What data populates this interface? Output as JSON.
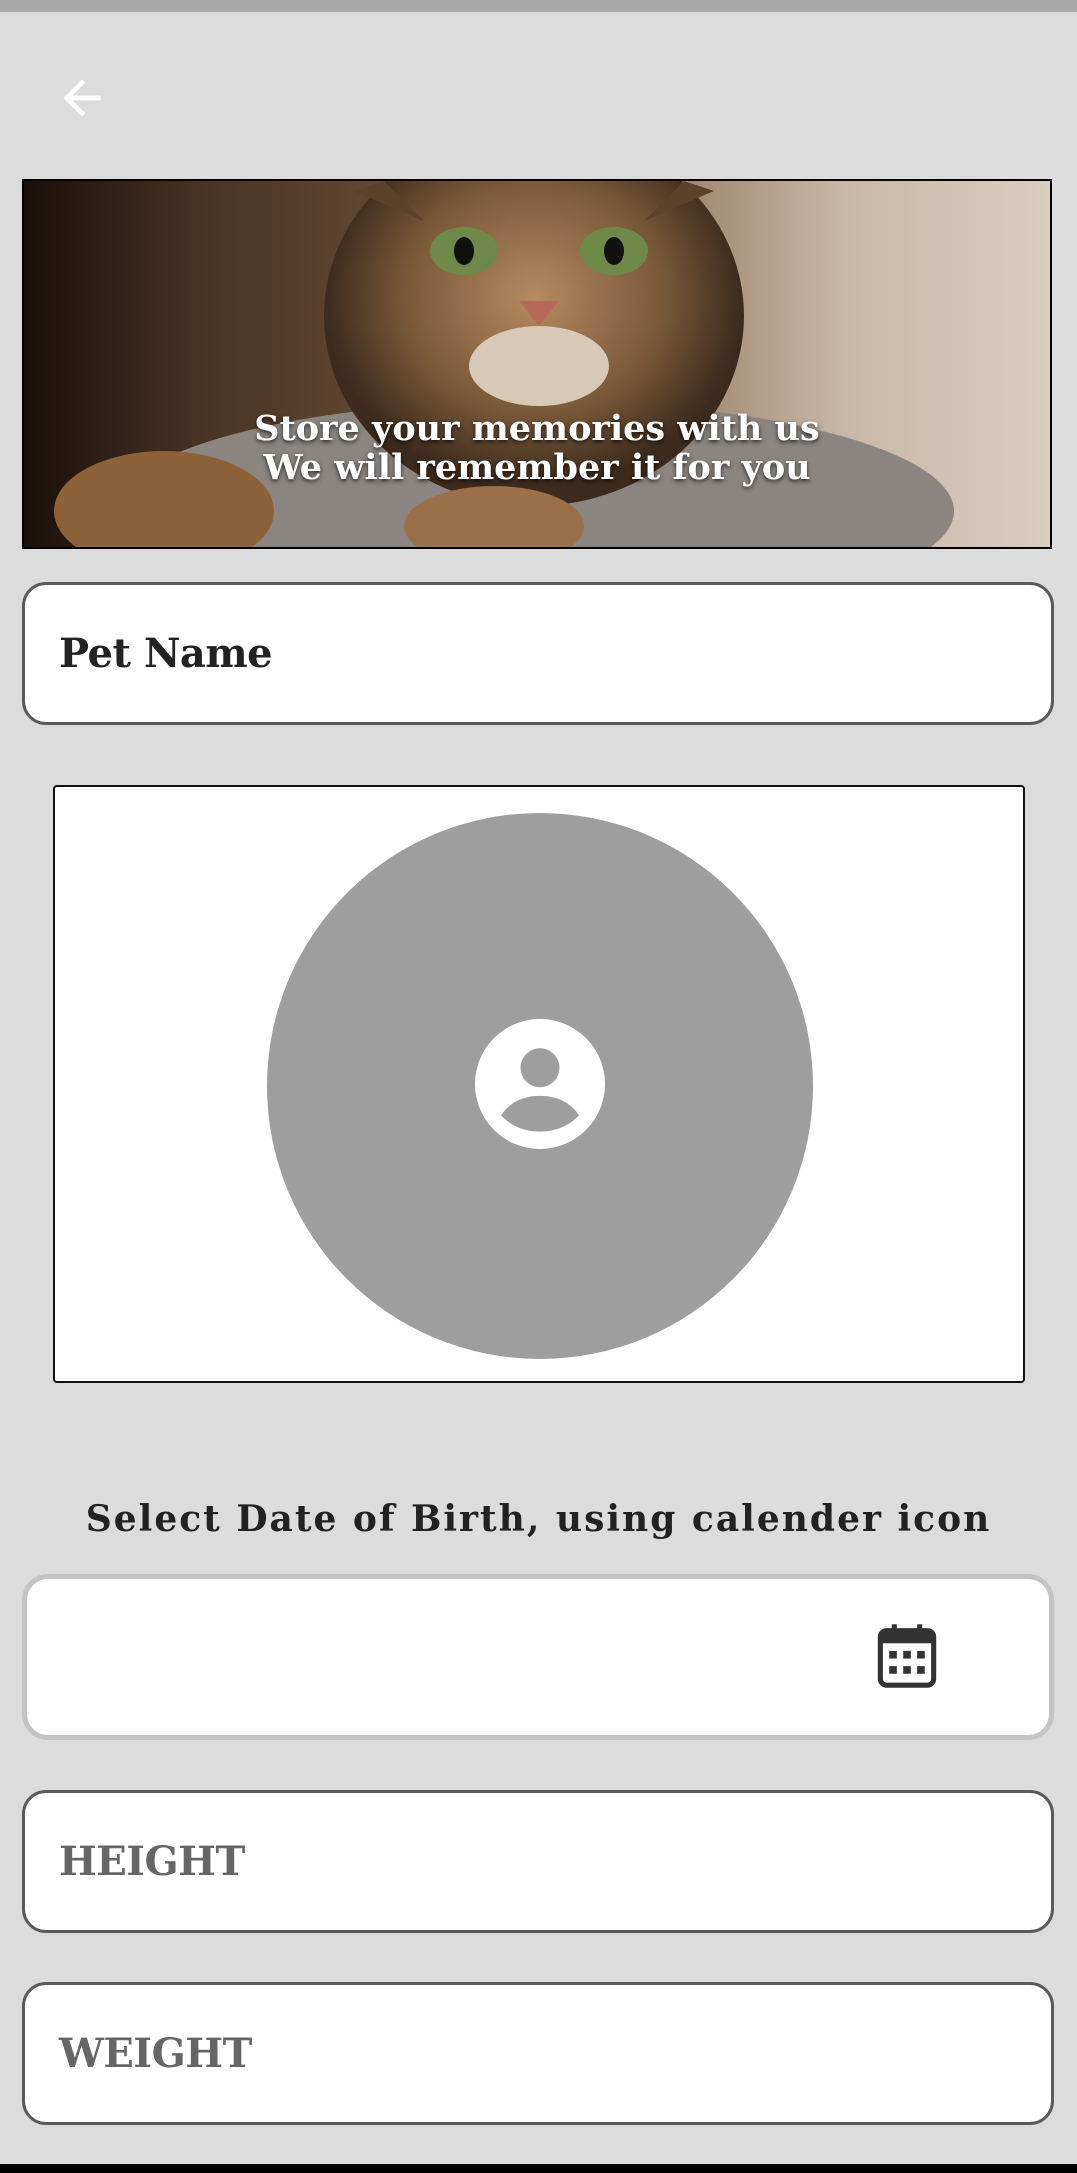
{
  "banner": {
    "line1": "Store your memories with us",
    "line2": "We will remember it for you"
  },
  "form": {
    "pet_name_label": "Pet Name",
    "dob_instruction": "Select Date of Birth, using calender icon",
    "dob_value": "",
    "height_label": "HEIGHT",
    "weight_label": "WEIGHT"
  },
  "icons": {
    "back": "arrow-left-icon",
    "avatar": "account-circle-icon",
    "calendar": "calendar-icon"
  },
  "colors": {
    "background": "#dcdcdc",
    "avatar_placeholder": "#9e9e9e",
    "field_border": "#5a5a5a"
  }
}
